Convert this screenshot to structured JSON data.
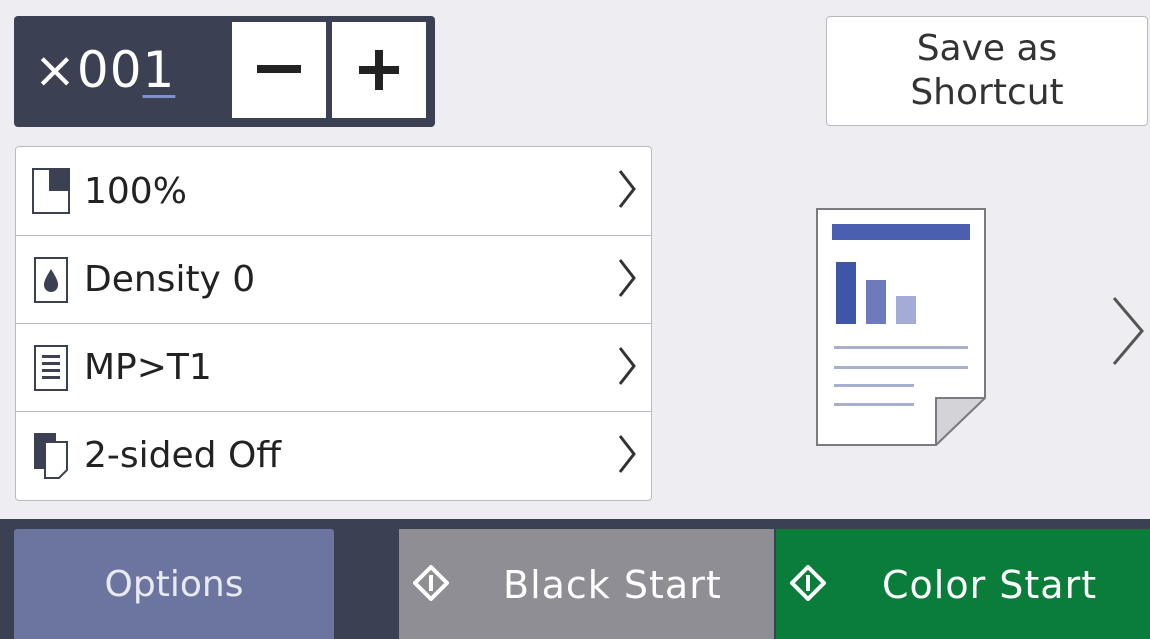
{
  "copies": {
    "prefix": "×00",
    "cursor_digit": "1",
    "minus_label": "−",
    "plus_label": "+"
  },
  "shortcut": {
    "label": "Save as\nShortcut"
  },
  "settings": [
    {
      "label": "100%",
      "icon": "enlarge-reduce-icon"
    },
    {
      "label": "Density 0",
      "icon": "density-drop-icon"
    },
    {
      "label": "MP>T1",
      "icon": "tray-use-icon"
    },
    {
      "label": "2-sided Off",
      "icon": "two-sided-icon"
    }
  ],
  "preview": {
    "icon": "document-preview-icon",
    "accent": "#3f5aa8"
  },
  "footer": {
    "options_label": "Options",
    "black_start_label": "Black Start",
    "color_start_label": "Color Start"
  },
  "colors": {
    "header_dark": "#3b4152",
    "options_bg": "#6c74a0",
    "black_start_bg": "#8e8e94",
    "color_start_bg": "#0a7d3a",
    "background": "#eeeef2"
  }
}
